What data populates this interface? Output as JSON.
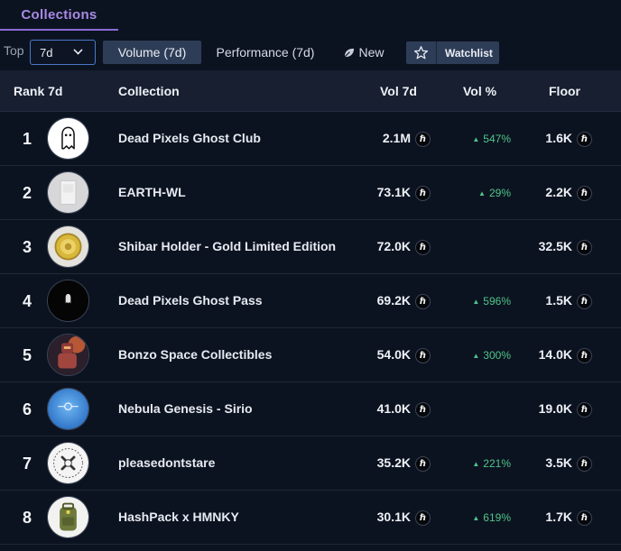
{
  "tabs": {
    "collections_label": "Collections"
  },
  "filters": {
    "top_label": "Top",
    "period_value": "7d",
    "volume_label": "Volume (7d)",
    "performance_label": "Performance (7d)",
    "new_label": "New",
    "watchlist_label": "Watchlist"
  },
  "table": {
    "headers": {
      "rank": "Rank 7d",
      "collection": "Collection",
      "vol": "Vol 7d",
      "vol_pct": "Vol %",
      "floor": "Floor"
    },
    "currency_glyph": "ℏ",
    "rows": [
      {
        "rank": "1",
        "name": "Dead Pixels Ghost Club",
        "volume": "2.1M",
        "vol_pct": "547%",
        "floor": "1.6K",
        "avatar": "ghost-avatar"
      },
      {
        "rank": "2",
        "name": "EARTH-WL",
        "volume": "73.1K",
        "vol_pct": "29%",
        "floor": "2.2K",
        "avatar": "white-card-avatar"
      },
      {
        "rank": "3",
        "name": "Shibar Holder - Gold Limited Edition",
        "volume": "72.0K",
        "vol_pct": "",
        "floor": "32.5K",
        "avatar": "gold-coin-avatar"
      },
      {
        "rank": "4",
        "name": "Dead Pixels Ghost Pass",
        "volume": "69.2K",
        "vol_pct": "596%",
        "floor": "1.5K",
        "avatar": "ghost-pass-avatar"
      },
      {
        "rank": "5",
        "name": "Bonzo Space Collectibles",
        "volume": "54.0K",
        "vol_pct": "300%",
        "floor": "14.0K",
        "avatar": "robot-avatar"
      },
      {
        "rank": "6",
        "name": "Nebula Genesis - Sirio",
        "volume": "41.0K",
        "vol_pct": "",
        "floor": "19.0K",
        "avatar": "nebula-avatar"
      },
      {
        "rank": "7",
        "name": "pleasedontstare",
        "volume": "35.2K",
        "vol_pct": "221%",
        "floor": "3.5K",
        "avatar": "x-pattern-avatar"
      },
      {
        "rank": "8",
        "name": "HashPack x HMNKY",
        "volume": "30.1K",
        "vol_pct": "619%",
        "floor": "1.7K",
        "avatar": "backpack-avatar"
      }
    ]
  },
  "colors": {
    "accent": "#a98ae6",
    "positive": "#4fc58a",
    "background": "#0c1320",
    "header_bg": "#171f30",
    "button_bg": "#2e3d57"
  }
}
